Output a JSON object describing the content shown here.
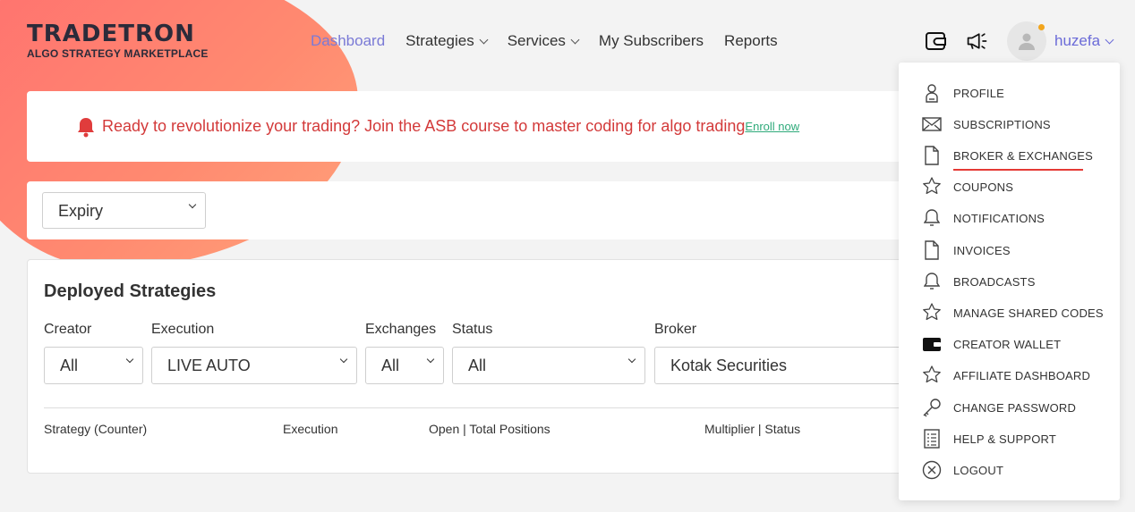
{
  "logo": {
    "main": "TRADETRON",
    "sub": "ALGO STRATEGY MARKETPLACE"
  },
  "nav": {
    "items": [
      {
        "label": "Dashboard",
        "active": true
      },
      {
        "label": "Strategies",
        "dropdown": true
      },
      {
        "label": "Services",
        "dropdown": true
      },
      {
        "label": "My Subscribers"
      },
      {
        "label": "Reports"
      }
    ]
  },
  "header": {
    "icons": [
      "wallet-icon",
      "megaphone-icon"
    ],
    "username": "huzefa"
  },
  "banner": {
    "text": "Ready to revolutionize your trading? Join the ASB course to master coding for algo trading",
    "link": "Enroll now"
  },
  "filter": {
    "expiry_value": "Expiry"
  },
  "deployed": {
    "title": "Deployed Strategies",
    "filters": {
      "creator": {
        "label": "Creator",
        "value": "All"
      },
      "execution": {
        "label": "Execution",
        "value": "LIVE AUTO"
      },
      "exchanges": {
        "label": "Exchanges",
        "value": "All"
      },
      "status": {
        "label": "Status",
        "value": "All"
      },
      "broker": {
        "label": "Broker",
        "value": "Kotak Securities"
      }
    },
    "columns": [
      "Strategy (Counter)",
      "Execution",
      "Open | Total Positions",
      "Multiplier | Status"
    ]
  },
  "user_menu": {
    "items": [
      {
        "label": "PROFILE",
        "icon": "profile-icon"
      },
      {
        "label": "SUBSCRIPTIONS",
        "icon": "envelope-icon"
      },
      {
        "label": "BROKER & EXCHANGES",
        "icon": "document-icon",
        "active": true
      },
      {
        "label": "COUPONS",
        "icon": "star-badge-icon"
      },
      {
        "label": "NOTIFICATIONS",
        "icon": "bell-icon"
      },
      {
        "label": "INVOICES",
        "icon": "document-icon"
      },
      {
        "label": "BROADCASTS",
        "icon": "bell-icon"
      },
      {
        "label": "MANAGE SHARED CODES",
        "icon": "star-badge-icon"
      },
      {
        "label": "CREATOR WALLET",
        "icon": "wallet-icon"
      },
      {
        "label": "AFFILIATE DASHBOARD",
        "icon": "star-badge-icon"
      },
      {
        "label": "CHANGE PASSWORD",
        "icon": "key-icon"
      },
      {
        "label": "HELP & SUPPORT",
        "icon": "list-icon"
      },
      {
        "label": "LOGOUT",
        "icon": "close-circle-icon"
      }
    ]
  },
  "colors": {
    "accent": "#7a7ad6",
    "banner_text": "#d33a3a",
    "link": "#2eaa7a",
    "active_underline": "#e53935",
    "blob": "#ff7a72"
  }
}
